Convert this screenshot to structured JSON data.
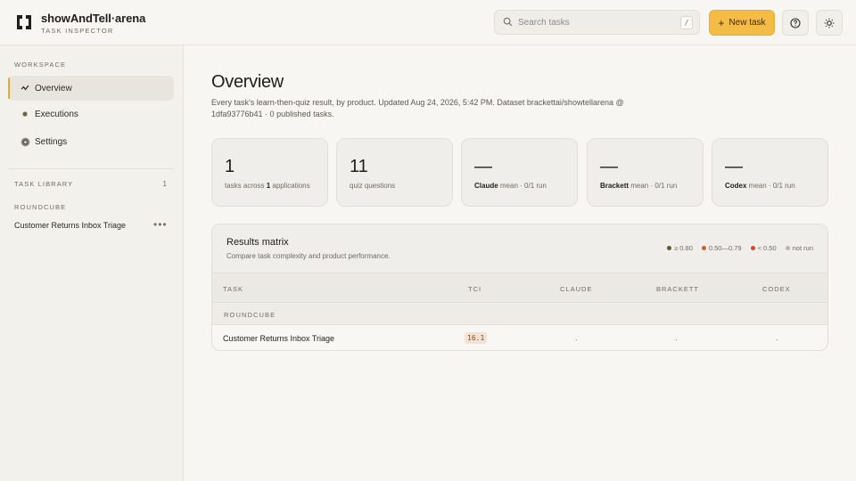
{
  "brand": {
    "name": "showAndTell·arena",
    "subtitle": "TASK INSPECTOR"
  },
  "search": {
    "placeholder": "Search tasks",
    "shortcut": "/"
  },
  "header": {
    "new_task_label": "New task",
    "help_icon": "question-circle-icon",
    "theme_icon": "sun-icon"
  },
  "sidebar": {
    "workspace_label": "WORKSPACE",
    "items": [
      {
        "label": "Overview",
        "icon": "activity-icon",
        "active": true
      },
      {
        "label": "Executions",
        "icon": "dot-icon",
        "active": false
      },
      {
        "label": "Settings",
        "icon": "gear-icon",
        "active": false
      }
    ],
    "library_label": "TASK LIBRARY",
    "library_count": "1",
    "library_group": "ROUNDCUBE",
    "library_item": "Customer Returns Inbox Triage"
  },
  "main": {
    "title": "Overview",
    "description": "Every task's learn-then-quiz result, by product. Updated Aug 24, 2026, 5:42 PM. Dataset brackettai/showtellarena @ 1dfa93776b41 · 0 published tasks."
  },
  "stats": [
    {
      "value": "1",
      "caption_pre": "tasks across ",
      "caption_bold": "1",
      "caption_post": " applications"
    },
    {
      "value": "11",
      "caption": "quiz questions"
    },
    {
      "value": "—",
      "label": "Claude",
      "caption": " mean · 0/1 run"
    },
    {
      "value": "—",
      "label": "Brackett",
      "caption": " mean · 0/1 run"
    },
    {
      "value": "—",
      "label": "Codex",
      "caption": " mean · 0/1 run"
    }
  ],
  "matrix": {
    "title": "Results matrix",
    "subtitle": "Compare task complexity and product performance.",
    "legend": [
      {
        "label": "≥ 0.80",
        "color": "#5b5a2e"
      },
      {
        "label": "0.50—0.79",
        "color": "#c8622e"
      },
      {
        "label": "< 0.50",
        "color": "#d24a36"
      },
      {
        "label": "not run",
        "color": "#b9b5ad"
      }
    ],
    "columns": [
      "TASK",
      "TCI",
      "CLAUDE",
      "BRACKETT",
      "CODEX"
    ],
    "group": "ROUNDCUBE",
    "rows": [
      {
        "task": "Customer Returns Inbox Triage",
        "tci": "16.1",
        "claude": "·",
        "brackett": "·",
        "codex": "·"
      }
    ]
  },
  "colors": {
    "accent": "#f4bc45",
    "background": "#f7f6f2"
  }
}
